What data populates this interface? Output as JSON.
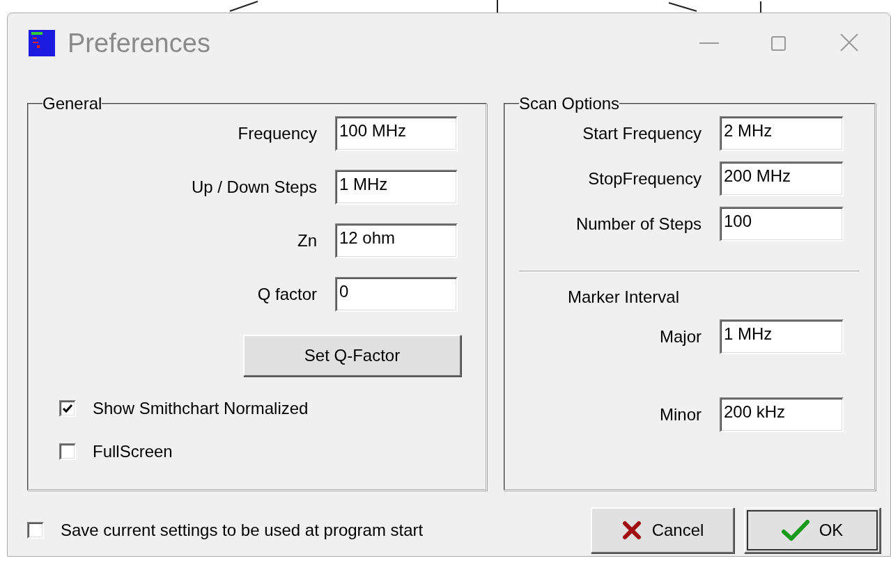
{
  "window": {
    "title": "Preferences"
  },
  "general": {
    "title": "General",
    "fields": [
      {
        "label": "Frequency",
        "value": "100 MHz"
      },
      {
        "label": "Up / Down Steps",
        "value": "1 MHz"
      },
      {
        "label": "Zn",
        "value": "12 ohm"
      },
      {
        "label": "Q factor",
        "value": "0"
      }
    ],
    "button": "Set Q-Factor",
    "options": [
      {
        "label": "Show Smithchart Normalized",
        "checked": true
      },
      {
        "label": "FullScreen",
        "checked": false
      }
    ]
  },
  "scan_options": {
    "title": "Scan Options",
    "fields": [
      {
        "label": "Start Frequency",
        "value": "2 MHz"
      },
      {
        "label": "StopFrequency",
        "value": "200 MHz"
      },
      {
        "label": "Number of Steps",
        "value": "100"
      }
    ],
    "marker_interval": {
      "title": "Marker Interval",
      "fields": [
        {
          "label": "Major",
          "value": "1 MHz"
        },
        {
          "label": "Minor",
          "value": "200 kHz"
        }
      ]
    }
  },
  "save_on_start": {
    "label": "Save current settings to be used at program start",
    "checked": false
  },
  "buttons": [
    {
      "label": "Cancel",
      "kind": "cancel"
    },
    {
      "label": "OK",
      "kind": "ok"
    }
  ]
}
